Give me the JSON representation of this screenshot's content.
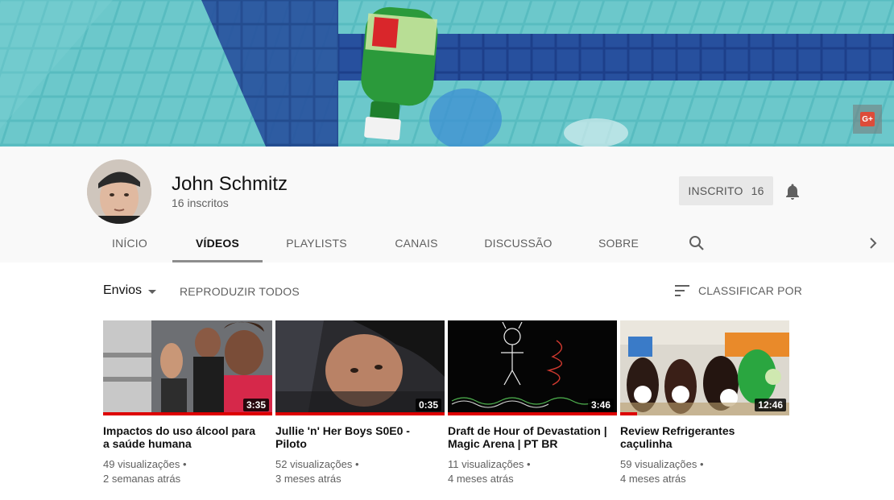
{
  "banner": {
    "gplus_label": "G+"
  },
  "channel": {
    "name": "John Schmitz",
    "subscribers": "16 inscritos",
    "subscribe_label": "INSCRITO",
    "subscribe_count": "16"
  },
  "tabs": [
    {
      "label": "INÍCIO"
    },
    {
      "label": "VÍDEOS"
    },
    {
      "label": "PLAYLISTS"
    },
    {
      "label": "CANAIS"
    },
    {
      "label": "DISCUSSÃO"
    },
    {
      "label": "SOBRE"
    }
  ],
  "active_tab": "VÍDEOS",
  "toolbar": {
    "uploads_label": "Envios",
    "play_all_label": "REPRODUZIR TODOS",
    "sort_label": "CLASSIFICAR POR"
  },
  "videos": [
    {
      "title": "Impactos do uso álcool para a saúde humana",
      "duration": "3:35",
      "views": "49 visualizações",
      "age": "2 semanas atrás",
      "progress": 1.0
    },
    {
      "title": "Jullie 'n' Her Boys S0E0 - Piloto",
      "duration": "0:35",
      "views": "52 visualizações",
      "age": "3 meses atrás",
      "progress": 1.0
    },
    {
      "title": "Draft de Hour of Devastation | Magic Arena | PT BR",
      "duration": "3:46",
      "views": "11 visualizações",
      "age": "4 meses atrás",
      "progress": 1.0
    },
    {
      "title": "Review Refrigerantes caçulinha",
      "duration": "12:46",
      "views": "59 visualizações",
      "age": "4 meses atrás",
      "progress": 0.1
    }
  ],
  "icons": {
    "bell": "bell-icon",
    "search": "search-icon",
    "next": "chevron-right-icon",
    "sort": "sort-icon",
    "gplus": "google-plus-icon"
  },
  "colors": {
    "progress": "#dd0000",
    "gplus": "#dd4b39"
  }
}
